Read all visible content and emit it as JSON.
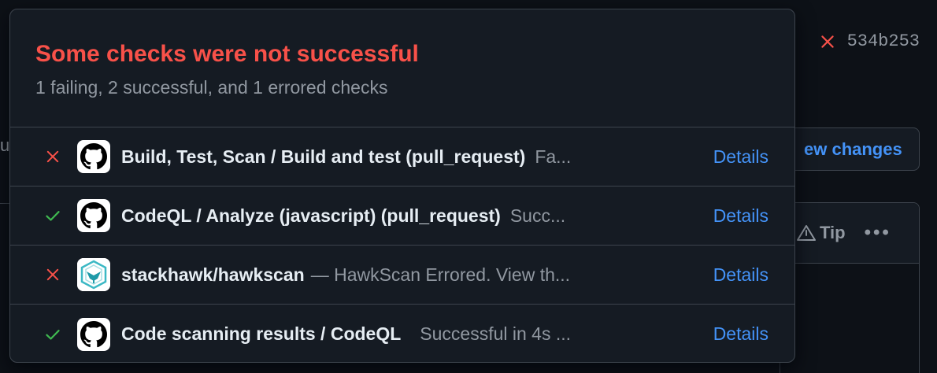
{
  "background": {
    "commit_sha": "534b253",
    "view_changes_label": "ew changes",
    "left_fragment": "u",
    "tip_label": "Tip",
    "more_label": "•••"
  },
  "popover": {
    "title": "Some checks were not successful",
    "subtitle": "1 failing, 2 successful, and 1 errored checks",
    "checks": [
      {
        "status": "failed",
        "avatar": "github-icon",
        "name": "Build, Test, Scan / Build and test (pull_request)",
        "desc": "Fa...",
        "details_label": "Details"
      },
      {
        "status": "success",
        "avatar": "github-icon",
        "name": "CodeQL / Analyze (javascript) (pull_request)",
        "desc": "Succ...",
        "details_label": "Details"
      },
      {
        "status": "failed",
        "avatar": "stackhawk-icon",
        "name": "stackhawk/hawkscan",
        "desc": "— HawkScan Errored. View th...",
        "details_label": "Details"
      },
      {
        "status": "success",
        "avatar": "github-icon",
        "name": "Code scanning results / CodeQL",
        "desc": "Successful in 4s ...",
        "details_label": "Details"
      }
    ]
  },
  "colors": {
    "error": "#f85149",
    "success": "#3fb950",
    "link": "#4493f8",
    "muted": "#9198a1"
  }
}
